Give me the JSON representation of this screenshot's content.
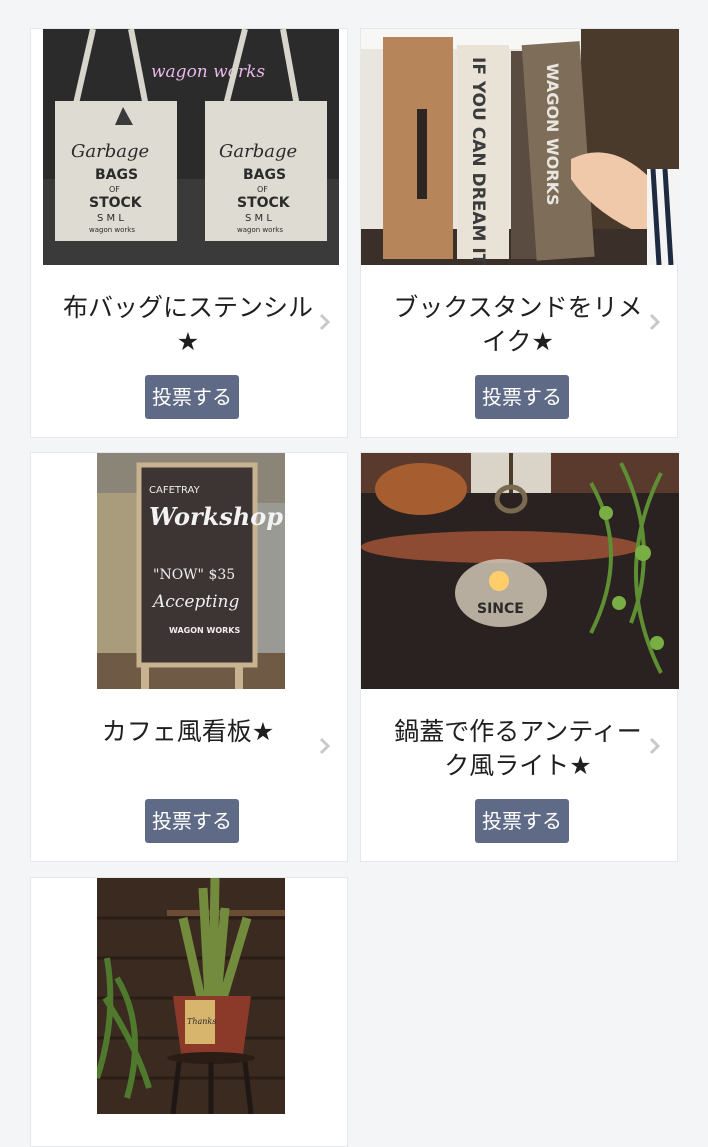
{
  "items": [
    {
      "title": "布バッグにステンシル★",
      "vote_label": "投票する",
      "image_text": {
        "brand": "wagon works",
        "bag_line1": "Garbage",
        "bag_line2": "BAGS",
        "bag_line3": "OF",
        "bag_line4": "STOCK",
        "bag_line5": "S M L",
        "bag_line6": "wagon works"
      }
    },
    {
      "title": "ブックスタンドをリメイク★",
      "vote_label": "投票する",
      "image_text": {
        "board1": "IF YOU CAN DREAM IT",
        "board2": "WAGON WORKS"
      }
    },
    {
      "title": "カフェ風看板★",
      "vote_label": "投票する",
      "image_text": {
        "line1": "CAFETRAY",
        "line2": "Workshop",
        "line3": "\"NOW\"  $35",
        "line4": "Accepting",
        "line5": "WAGON WORKS"
      }
    },
    {
      "title": "鍋蓋で作るアンティーク風ライト★",
      "vote_label": "投票する",
      "image_text": {
        "jar": "SINCE"
      }
    },
    {
      "title": "",
      "vote_label": "",
      "image_text": {
        "pot_label": "Thanks"
      }
    }
  ],
  "icons": {
    "chevron": "chevron-right-icon"
  },
  "colors": {
    "page_background": "#f4f5f7",
    "card_background": "#ffffff",
    "vote_button": "#5f6b86",
    "vote_text": "#ffffff",
    "title_text": "#1f1f1f",
    "chevron": "#c8c8c8"
  }
}
